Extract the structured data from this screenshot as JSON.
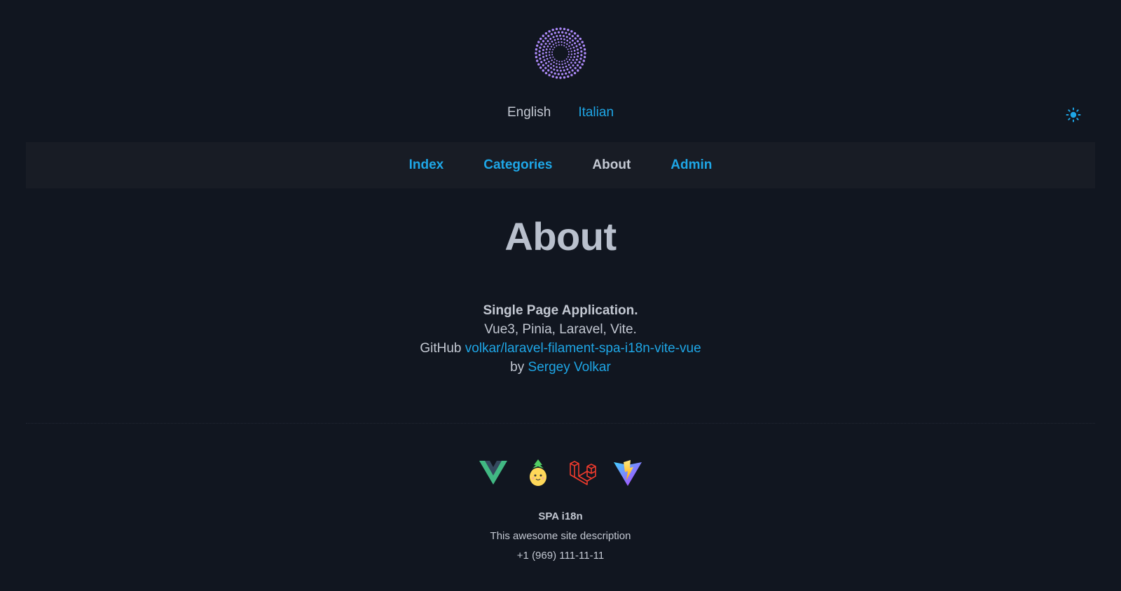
{
  "header": {
    "languages": [
      {
        "label": "English",
        "active": true
      },
      {
        "label": "Italian",
        "active": false
      }
    ],
    "theme_toggle_icon": "sun-icon"
  },
  "nav": {
    "items": [
      {
        "label": "Index",
        "current": false
      },
      {
        "label": "Categories",
        "current": false
      },
      {
        "label": "About",
        "current": true
      },
      {
        "label": "Admin",
        "current": false
      }
    ]
  },
  "main": {
    "title": "About",
    "tagline": "Single Page Application.",
    "stack": "Vue3, Pinia, Laravel, Vite.",
    "github_prefix": "GitHub",
    "github_link": "volkar/laravel-filament-spa-i18n-vite-vue",
    "author_prefix": "by",
    "author_link": "Sergey Volkar"
  },
  "footer": {
    "icons": [
      "vue-icon",
      "pinia-icon",
      "laravel-icon",
      "vite-icon"
    ],
    "site_name": "SPA i18n",
    "description": "This awesome site description",
    "phone": "+1 (969) 111-11-11"
  },
  "colors": {
    "background": "#111620",
    "nav_background": "#181c25",
    "accent": "#1ea6e6",
    "text": "#c3c8d2"
  }
}
